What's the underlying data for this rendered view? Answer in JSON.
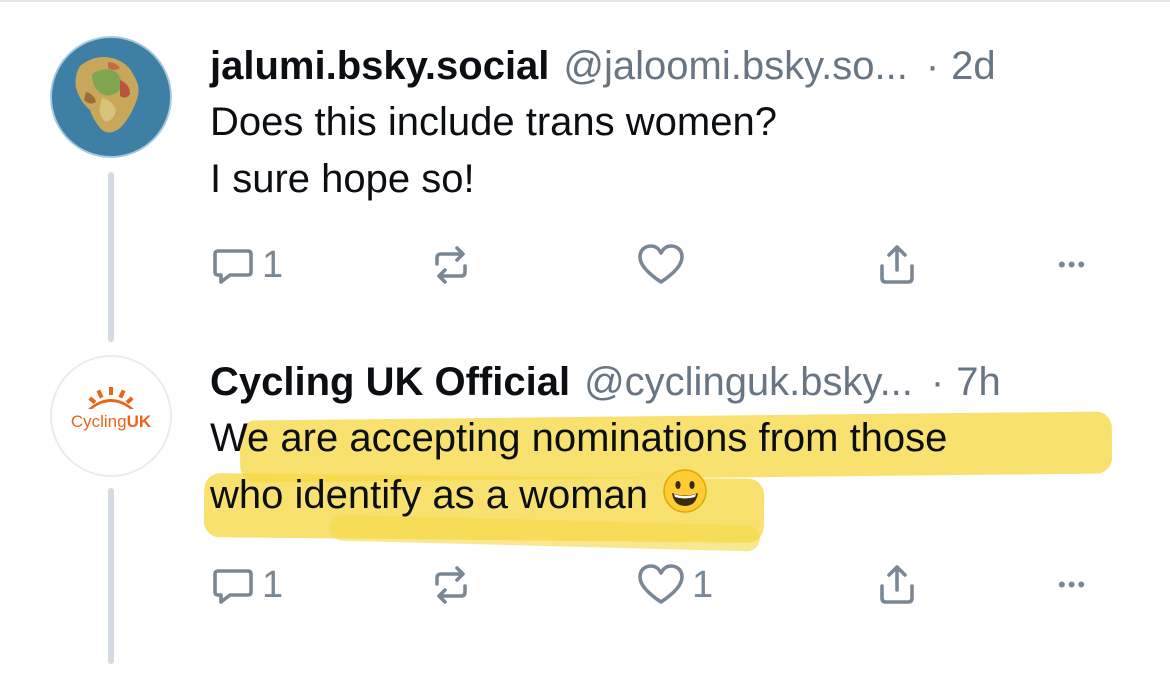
{
  "posts": [
    {
      "display_name": "jalumi.bsky.social",
      "handle": "@jaloomi.bsky.so...",
      "separator": "·",
      "time": "2d",
      "text_lines": [
        "Does this include trans women?",
        "I sure hope so!"
      ],
      "actions": {
        "reply_count": "1",
        "repost_count": "",
        "like_count": "",
        "more": "•••"
      },
      "avatar_icon": "globe-map-avatar-icon"
    },
    {
      "display_name": "Cycling UK Official",
      "handle": "@cyclinguk.bsky...",
      "separator": "·",
      "time": "7h",
      "avatar_text": {
        "prefix": "Cycling",
        "suffix": "UK"
      },
      "text_lines": [
        "We are accepting nominations from those",
        "who identify as a woman"
      ],
      "emoji": "grinning-face-emoji",
      "actions": {
        "reply_count": "1",
        "repost_count": "",
        "like_count": "1",
        "more": "•••"
      }
    }
  ],
  "colors": {
    "icon_gray": "#7a8896",
    "handle_gray": "#687684",
    "highlight_yellow": "#f6d847",
    "cycling_orange": "#e8661c",
    "thread_line": "#d4dbe2"
  }
}
